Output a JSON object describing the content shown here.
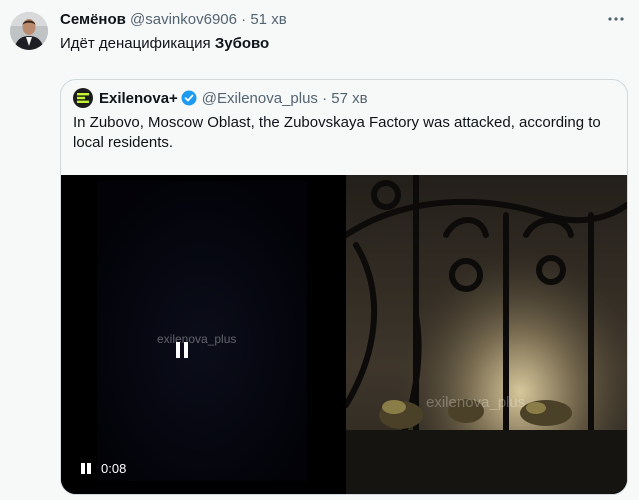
{
  "tweet": {
    "author_name": "Семёнов",
    "author_handle": "@savinkov6906",
    "separator": "·",
    "time": "51 хв",
    "more_icon": "more-dots-icon",
    "text_prefix": "Идёт денацификация",
    "text_bold": "Зубово"
  },
  "quote": {
    "author_name": "Exilenova+",
    "verified_icon": "verified-badge-icon",
    "author_handle": "@Exilenova_plus",
    "separator": "·",
    "time": "57 хв",
    "text": "In Zubovo, Moscow Oblast, the Zubovskaya Factory was attacked, according to local residents."
  },
  "video": {
    "watermark": "exilenova_plus",
    "time": "0:08",
    "state": "playing"
  },
  "colors": {
    "accent": "#1d9bf0",
    "logo_green": "#c6f432",
    "muted": "#536471"
  }
}
